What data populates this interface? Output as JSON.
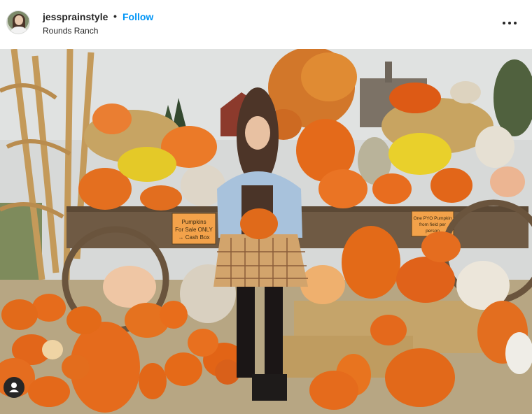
{
  "post": {
    "username": "jessprainstyle",
    "separator": "•",
    "follow_label": "Follow",
    "location": "Rounds Ranch"
  },
  "icons": {
    "more": "more-options-icon",
    "tag": "user-tag-icon"
  },
  "photo": {
    "sign_left": [
      "Pumpkins",
      "For Sale ONLY",
      "→ Cash Box"
    ],
    "sign_right": [
      "One PYO Pumpkin",
      "from field per",
      "person"
    ]
  },
  "colors": {
    "accent": "#0095f6",
    "text": "#262626"
  }
}
